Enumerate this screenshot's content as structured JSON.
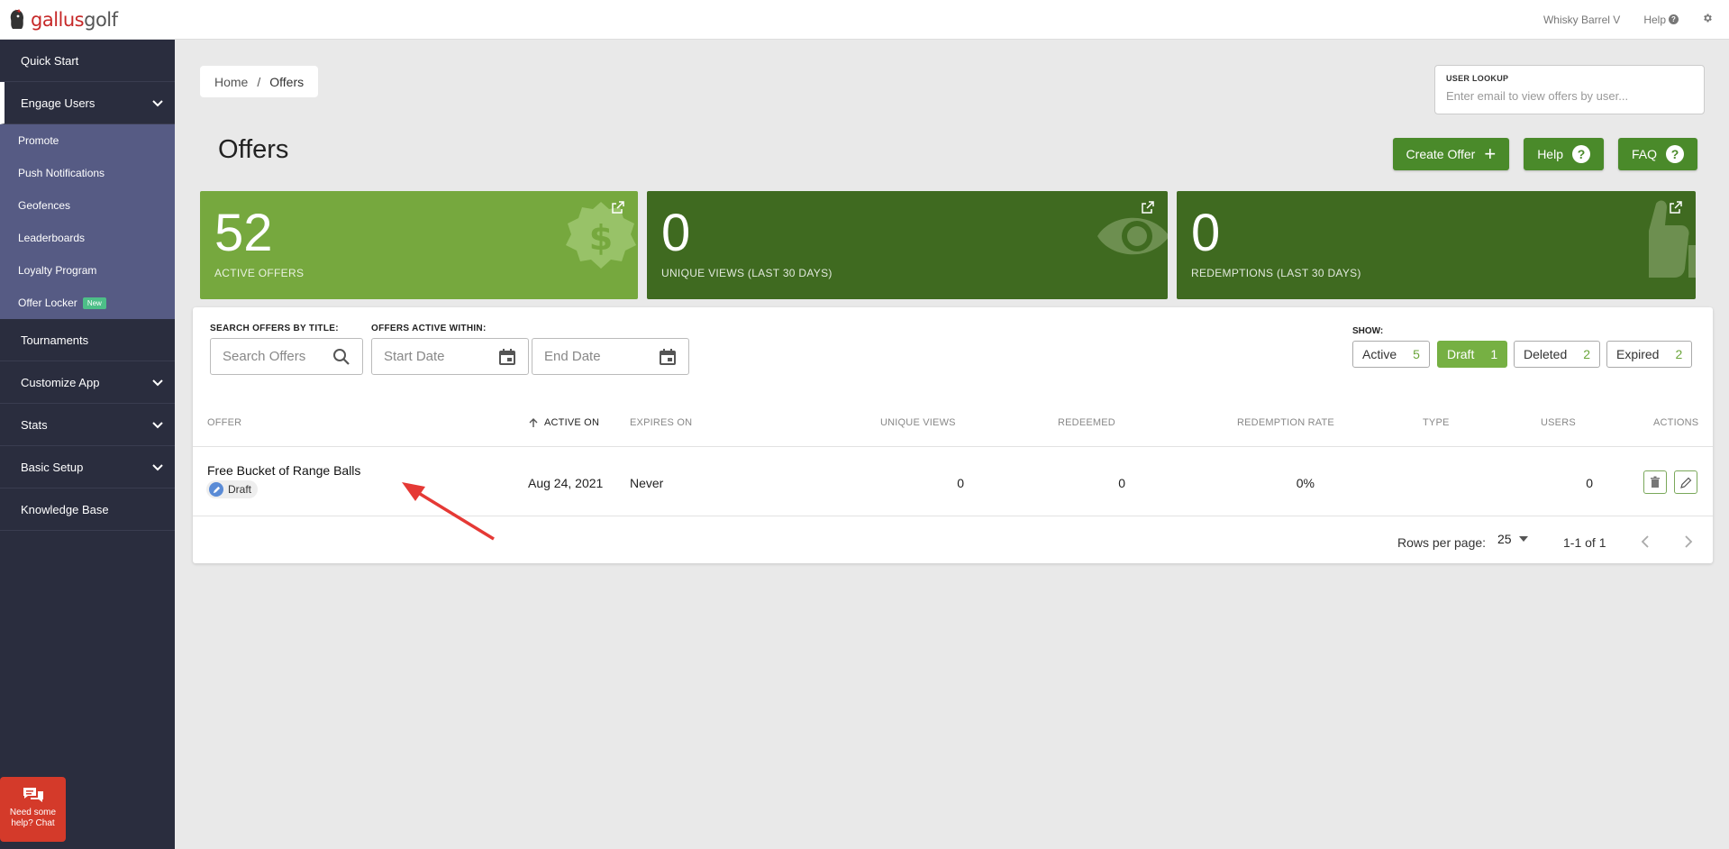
{
  "brand": {
    "name_part1": "gallus",
    "name_part2": "golf"
  },
  "topbar": {
    "account": "Whisky Barrel V",
    "help_label": "Help"
  },
  "sidebar": {
    "items": [
      {
        "label": "Quick Start"
      },
      {
        "label": "Engage Users"
      },
      {
        "label": "Tournaments"
      },
      {
        "label": "Customize App"
      },
      {
        "label": "Stats"
      },
      {
        "label": "Basic Setup"
      },
      {
        "label": "Knowledge Base"
      }
    ],
    "sub_items": [
      {
        "label": "Promote"
      },
      {
        "label": "Push Notifications"
      },
      {
        "label": "Geofences"
      },
      {
        "label": "Leaderboards"
      },
      {
        "label": "Loyalty Program"
      },
      {
        "label": "Offer Locker",
        "badge": "New"
      }
    ],
    "chat_line1": "Need some",
    "chat_line2": "help? Chat"
  },
  "breadcrumb": {
    "home": "Home",
    "sep": "/",
    "current": "Offers"
  },
  "user_lookup": {
    "label": "USER LOOKUP",
    "placeholder": "Enter email to view offers by user..."
  },
  "page": {
    "title": "Offers"
  },
  "buttons": {
    "create": "Create Offer",
    "help": "Help",
    "faq": "FAQ"
  },
  "stats": [
    {
      "value": "52",
      "label": "ACTIVE OFFERS",
      "color": "#76a83e"
    },
    {
      "value": "0",
      "label": "UNIQUE VIEWS (LAST 30 DAYS)",
      "color": "#3f6a20"
    },
    {
      "value": "0",
      "label": "REDEMPTIONS (LAST 30 DAYS)",
      "color": "#3f6a20"
    }
  ],
  "filters": {
    "search_label": "SEARCH OFFERS BY TITLE:",
    "search_placeholder": "Search Offers",
    "active_within_label": "OFFERS ACTIVE WITHIN:",
    "start_placeholder": "Start Date",
    "end_placeholder": "End Date",
    "show_label": "SHOW:",
    "chips": [
      {
        "label": "Active",
        "count": "5"
      },
      {
        "label": "Draft",
        "count": "1",
        "selected": true
      },
      {
        "label": "Deleted",
        "count": "2"
      },
      {
        "label": "Expired",
        "count": "2"
      }
    ]
  },
  "table": {
    "headers": [
      "OFFER",
      "ACTIVE ON",
      "EXPIRES ON",
      "UNIQUE VIEWS",
      "REDEEMED",
      "REDEMPTION RATE",
      "TYPE",
      "USERS",
      "ACTIONS"
    ],
    "rows": [
      {
        "title": "Free Bucket of Range Balls",
        "status": "Draft",
        "active_on": "Aug 24, 2021",
        "expires_on": "Never",
        "unique_views": "0",
        "redeemed": "0",
        "redemption_rate": "0%",
        "type": "",
        "users": "0"
      }
    ]
  },
  "pagination": {
    "rows_per_page_label": "Rows per page:",
    "rows_per_page": "25",
    "range": "1-1 of 1"
  },
  "colors": {
    "accent_green": "#4a8a2a",
    "light_green": "#76b043",
    "sidebar": "#2a2d3e",
    "subnav": "#565b84",
    "annotation_arrow": "#e53935"
  }
}
